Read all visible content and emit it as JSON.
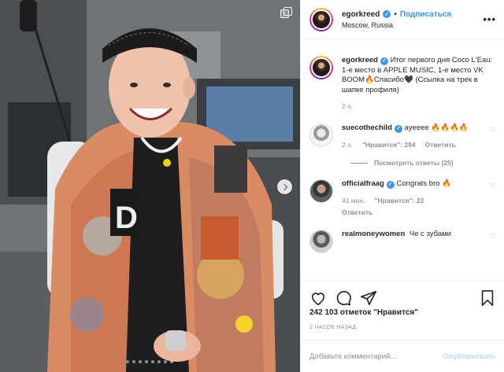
{
  "post": {
    "author": "egorkreed",
    "follow_label": "Подписаться",
    "location": "Moscow, Russia",
    "more_label": "•••"
  },
  "comments": [
    {
      "user": "egorkreed",
      "verified": true,
      "text": "Итог первого дня Coco L'Eau: 1-е место в APPLE MUSIC, 1-е место VK BOOM",
      "emoji1": "🔥",
      "text2": "Спасибо",
      "emoji2": "🖤",
      "text3": "(Ссылка на трек в шапке профиля)",
      "time": "2 ч."
    },
    {
      "user": "suecothechild",
      "verified": true,
      "text": "ayeeee",
      "emoji": "🔥🔥🔥🔥",
      "time": "2 ч.",
      "likes": "\"Нравится\": 294",
      "reply_label": "Ответить",
      "view_replies": "Посмотреть ответы (25)"
    },
    {
      "user": "officialfraag",
      "verified": true,
      "text": "Congrats bro",
      "emoji": "🔥",
      "time": "41 мин.",
      "likes": "\"Нравится\": 22",
      "reply_label": "Ответить"
    },
    {
      "user": "realmoneywomen",
      "verified": false,
      "text": "Че с зубами"
    }
  ],
  "actions": {
    "like_icon": "heart-icon",
    "comment_icon": "comment-icon",
    "share_icon": "share-icon",
    "save_icon": "bookmark-icon"
  },
  "likes_text": "242 103 отметок \"Нравится\"",
  "posted_time": "2 ЧАСОВ НАЗАД",
  "add_comment": {
    "placeholder": "Добавьте комментарий...",
    "publish_label": "Опубликовать"
  },
  "carousel": {
    "slides": 8,
    "active": 0
  },
  "colors": {
    "accent": "#3897f0",
    "publish_disabled": "#b2dffc",
    "muted": "#8e8e8e"
  }
}
